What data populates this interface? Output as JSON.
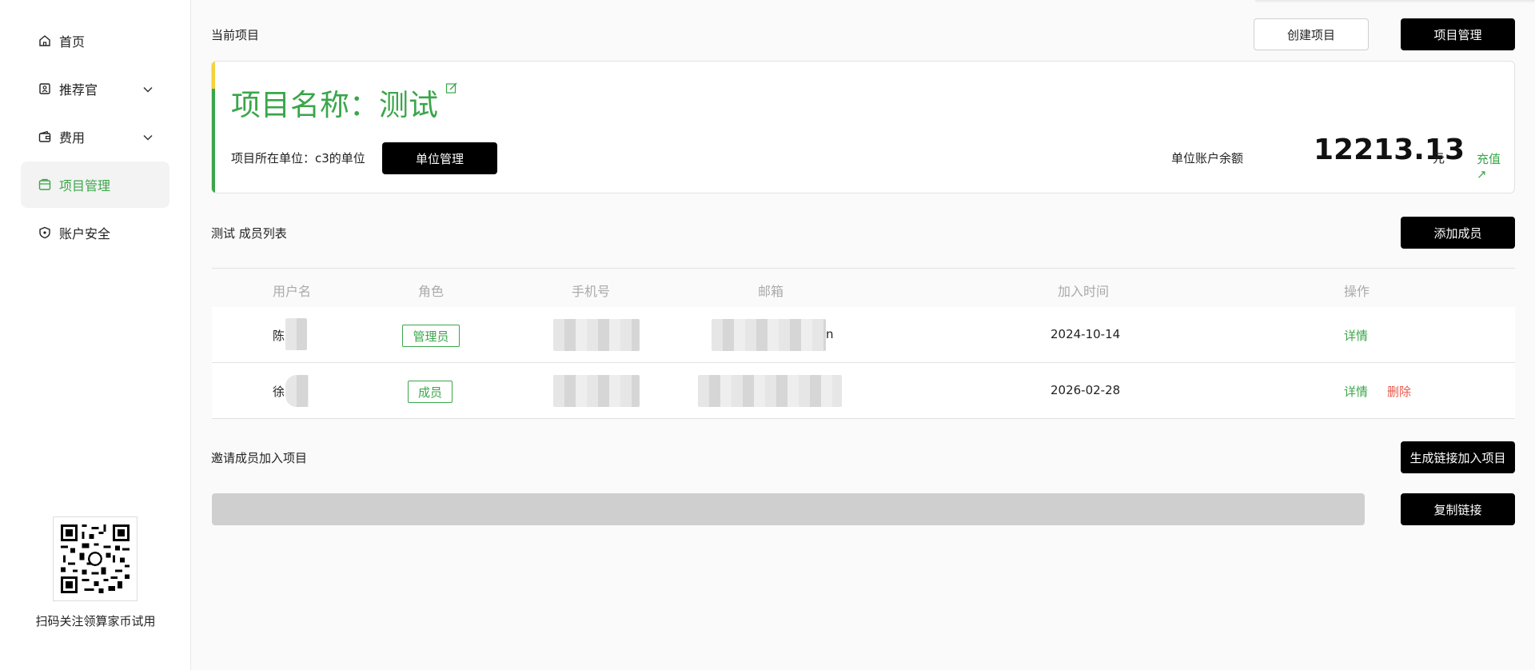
{
  "sidebar": {
    "items": [
      {
        "label": "首页",
        "icon": "home-icon"
      },
      {
        "label": "推荐官",
        "icon": "badge-icon",
        "expandable": true
      },
      {
        "label": "费用",
        "icon": "wallet-icon",
        "expandable": true
      },
      {
        "label": "项目管理",
        "icon": "project-icon",
        "active": true
      },
      {
        "label": "账户安全",
        "icon": "shield-icon"
      }
    ],
    "qr_caption": "扫码关注领算家币试用"
  },
  "header": {
    "current_project_label": "当前项目",
    "create_button": "创建项目",
    "manage_button": "项目管理"
  },
  "project": {
    "title": "项目名称：测试",
    "unit_label": "项目所在单位：c3的单位",
    "unit_manage_button": "单位管理",
    "balance_label": "单位账户余额",
    "balance": "12213.13",
    "currency": "元",
    "recharge": "充值 ↗"
  },
  "members": {
    "title": "测试 成员列表",
    "add_button": "添加成员",
    "columns": [
      "用户名",
      "角色",
      "手机号",
      "邮箱",
      "加入时间",
      "操作"
    ],
    "rows": [
      {
        "name": "陈",
        "role": "管理员",
        "email_suffix": "n",
        "joined": "2024-10-14",
        "actions": [
          "详情"
        ]
      },
      {
        "name": "徐",
        "role": "成员",
        "email_suffix": "",
        "joined": "2026-02-28",
        "actions": [
          "详情",
          "删除"
        ]
      }
    ]
  },
  "invite": {
    "label": "邀请成员加入项目",
    "generate_button": "生成链接加入项目",
    "copy_button": "复制链接",
    "link_value": ""
  },
  "colors": {
    "accent": "#3aa64a",
    "danger": "#e8574b",
    "highlight": "#f5d23b"
  }
}
